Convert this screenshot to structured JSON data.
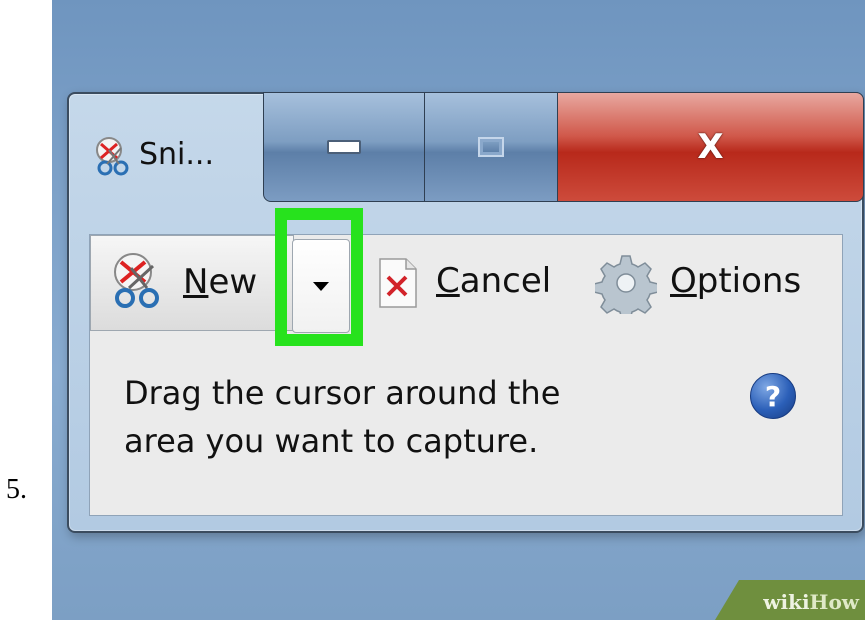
{
  "step": {
    "number": "5."
  },
  "window": {
    "title": "Sni...",
    "controls": {
      "minimize": "minimize-icon",
      "maximize": "maximize-icon",
      "close_glyph": "X"
    }
  },
  "toolbar": {
    "new_label": "New",
    "dropdown_icon": "chevron-down-icon",
    "cancel_label": "Cancel",
    "options_label": "Options"
  },
  "body": {
    "instruction_line1": "Drag the cursor around the",
    "instruction_line2": "area you want to capture.",
    "help_glyph": "?"
  },
  "highlight": {
    "color": "#27e21d"
  },
  "watermark": {
    "prefix": "wiki",
    "brand": "How"
  },
  "colors": {
    "close_button": "#c2362a",
    "caption_button": "#7e9ec2",
    "desktop": "#7fa2c8"
  }
}
